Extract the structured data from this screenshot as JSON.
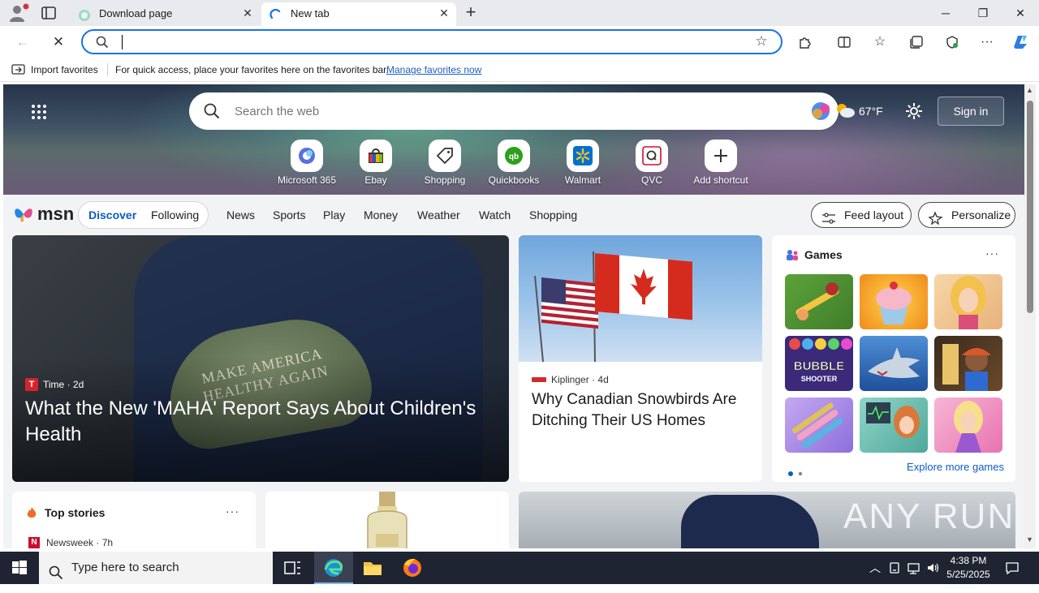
{
  "browser": {
    "tabs": [
      {
        "title": "Download page",
        "active": false
      },
      {
        "title": "New tab",
        "active": true
      }
    ],
    "address_value": "",
    "favorites_bar": {
      "import_label": "Import favorites",
      "message": "For quick access, place your favorites here on the favorites bar.",
      "manage_link": "Manage favorites now"
    }
  },
  "newtab": {
    "search_placeholder": "Search the web",
    "weather": {
      "temp": "67°F",
      "icon": "partly-cloudy-icon"
    },
    "signin_label": "Sign in",
    "shortcuts": [
      {
        "label": "Microsoft 365",
        "icon": "microsoft-365-icon"
      },
      {
        "label": "Ebay",
        "icon": "ebay-icon"
      },
      {
        "label": "Shopping",
        "icon": "shopping-tag-icon"
      },
      {
        "label": "Quickbooks",
        "icon": "quickbooks-icon"
      },
      {
        "label": "Walmart",
        "icon": "walmart-icon"
      },
      {
        "label": "QVC",
        "icon": "qvc-icon"
      },
      {
        "label": "Add shortcut",
        "icon": "plus-icon"
      }
    ]
  },
  "msn": {
    "logo": "msn",
    "pill_tabs": [
      "Discover",
      "Following"
    ],
    "nav_links": [
      "News",
      "Sports",
      "Play",
      "Money",
      "Weather",
      "Watch",
      "Shopping"
    ],
    "feed_layout_label": "Feed layout",
    "personalize_label": "Personalize"
  },
  "cards": {
    "lead": {
      "source": "Time",
      "age": "2d",
      "headline": "What the New 'MAHA' Report Says About Children's Health",
      "image_text": "MAKE AMERICA HEALTHY AGAIN"
    },
    "second": {
      "source": "Kiplinger",
      "age": "4d",
      "headline": "Why Canadian Snowbirds Are Ditching Their US Homes"
    },
    "games": {
      "title": "Games",
      "more": "···",
      "explore_label": "Explore more games",
      "bubble_title": "BUBBLE",
      "bubble_sub": "SHOOTER",
      "tiles": [
        "puzzle-rescue",
        "cupcake",
        "fashion-doll",
        "bubble-shooter",
        "shark",
        "escape-door",
        "makeup-brushes",
        "hospital",
        "dress-up"
      ]
    },
    "top_stories": {
      "title": "Top stories",
      "more": "···",
      "source": "Newsweek",
      "age": "7h"
    },
    "racing": {
      "watermark": "ANY RUN"
    }
  },
  "taskbar": {
    "search_placeholder": "Type here to search",
    "time": "4:38 PM",
    "date": "5/25/2025"
  },
  "colors": {
    "accent": "#0b5cc4",
    "address_border": "#1a73e8",
    "taskbar_bg": "#1f2433"
  }
}
